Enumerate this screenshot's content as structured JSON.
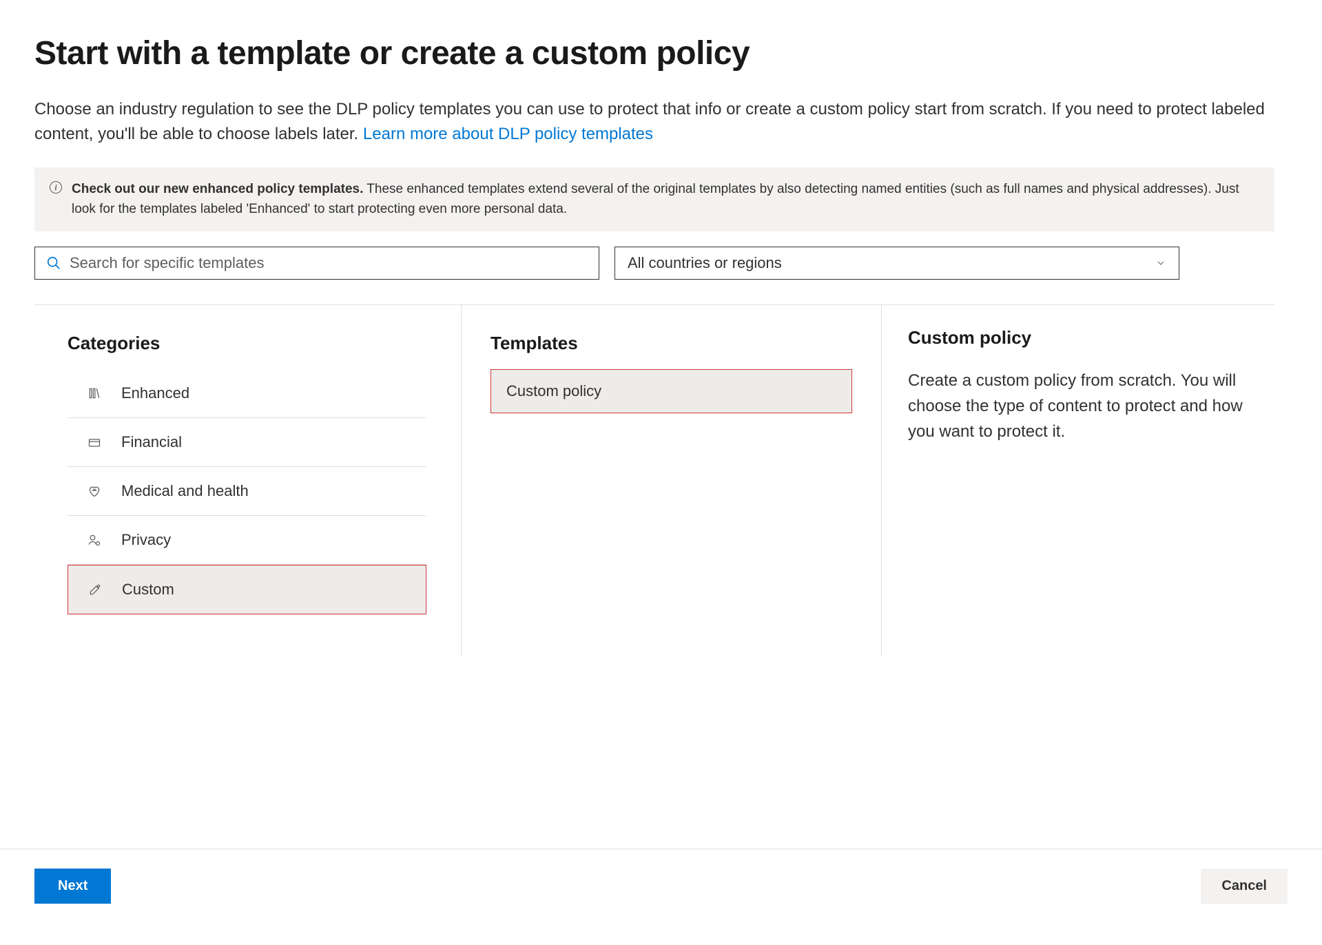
{
  "header": {
    "title": "Start with a template or create a custom policy",
    "description_text": "Choose an industry regulation to see the DLP policy templates you can use to protect that info or create a custom policy start from scratch. If you need to protect labeled content, you'll be able to choose labels later. ",
    "description_link": "Learn more about DLP policy templates"
  },
  "info_banner": {
    "bold": "Check out our new enhanced policy templates.",
    "rest": " These enhanced templates extend several of the original templates by also detecting named entities (such as full names and physical addresses). Just look for the templates labeled 'Enhanced' to start protecting even more personal data."
  },
  "filters": {
    "search_placeholder": "Search for specific templates",
    "region_selected": "All countries or regions"
  },
  "columns": {
    "categories_heading": "Categories",
    "templates_heading": "Templates",
    "categories": [
      {
        "label": "Enhanced",
        "icon": "enhanced"
      },
      {
        "label": "Financial",
        "icon": "financial"
      },
      {
        "label": "Medical and health",
        "icon": "medical"
      },
      {
        "label": "Privacy",
        "icon": "privacy"
      },
      {
        "label": "Custom",
        "icon": "custom",
        "selected": true
      }
    ],
    "templates": [
      {
        "label": "Custom policy",
        "selected": true
      }
    ],
    "detail": {
      "title": "Custom policy",
      "description": "Create a custom policy from scratch. You will choose the type of content to protect and how you want to protect it."
    }
  },
  "footer": {
    "next_label": "Next",
    "cancel_label": "Cancel"
  }
}
